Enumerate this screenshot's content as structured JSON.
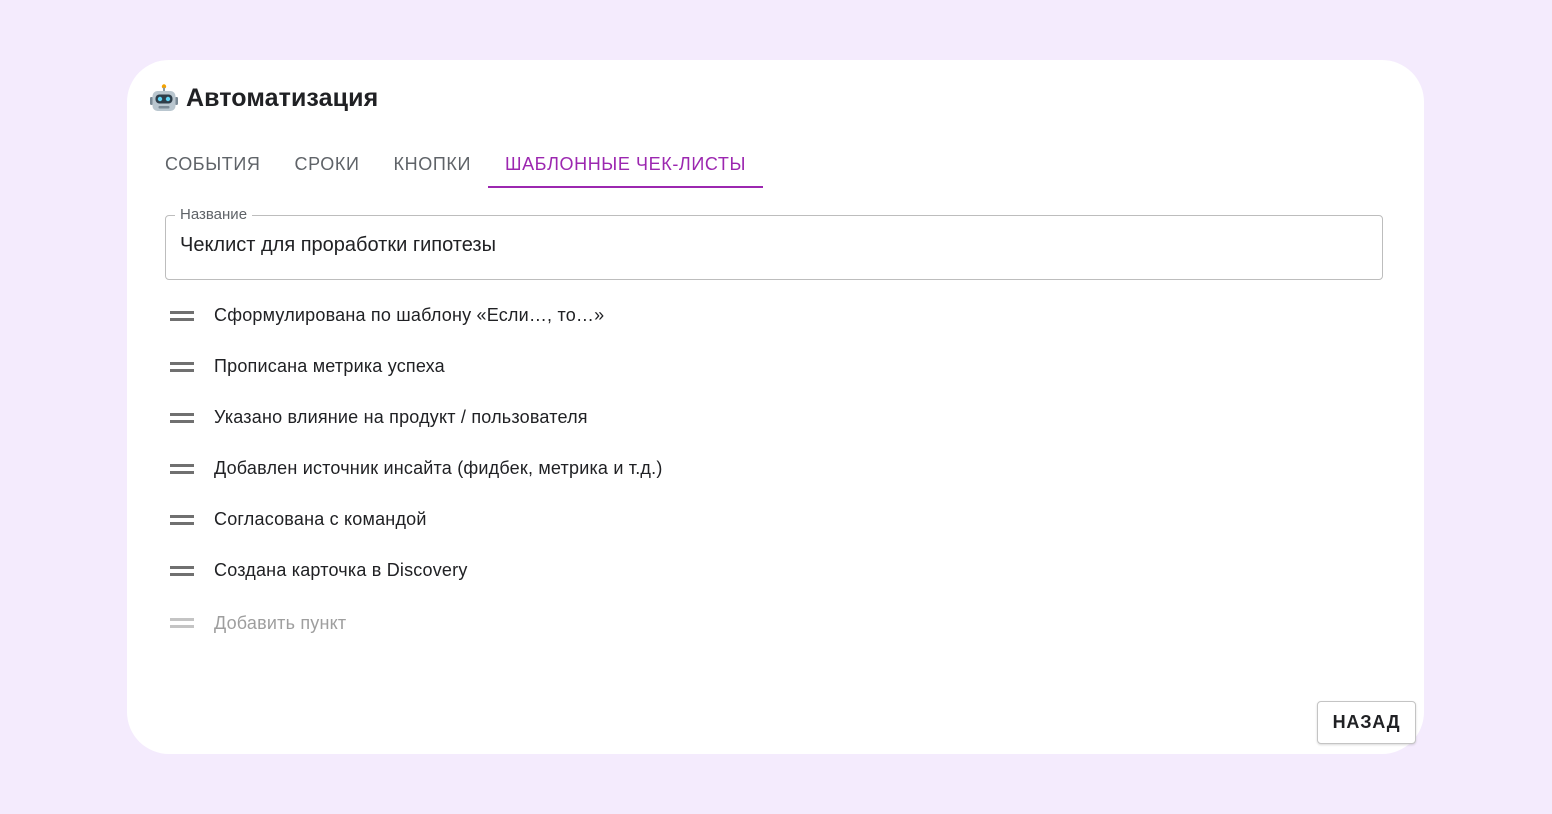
{
  "header": {
    "icon": "robot-icon",
    "title": "Автоматизация"
  },
  "tabs": [
    {
      "label": "СОБЫТИЯ",
      "active": false
    },
    {
      "label": "СРОКИ",
      "active": false
    },
    {
      "label": "КНОПКИ",
      "active": false
    },
    {
      "label": "ШАБЛОННЫЕ ЧЕК-ЛИСТЫ",
      "active": true
    }
  ],
  "form": {
    "name_label": "Название",
    "name_value": "Чеклист для проработки гипотезы"
  },
  "checklist": {
    "items": [
      "Сформулирована по шаблону «Если…, то…»",
      "Прописана метрика успеха",
      "Указано влияние на продукт / пользователя",
      "Добавлен источник инсайта (фидбек, метрика и т.д.)",
      "Согласована с командой",
      "Создана карточка в Discovery"
    ],
    "add_placeholder": "Добавить пункт"
  },
  "footer": {
    "back_label": "НАЗАД"
  },
  "colors": {
    "background": "#f4ebfd",
    "accent": "#9c27b0",
    "card": "#ffffff"
  }
}
